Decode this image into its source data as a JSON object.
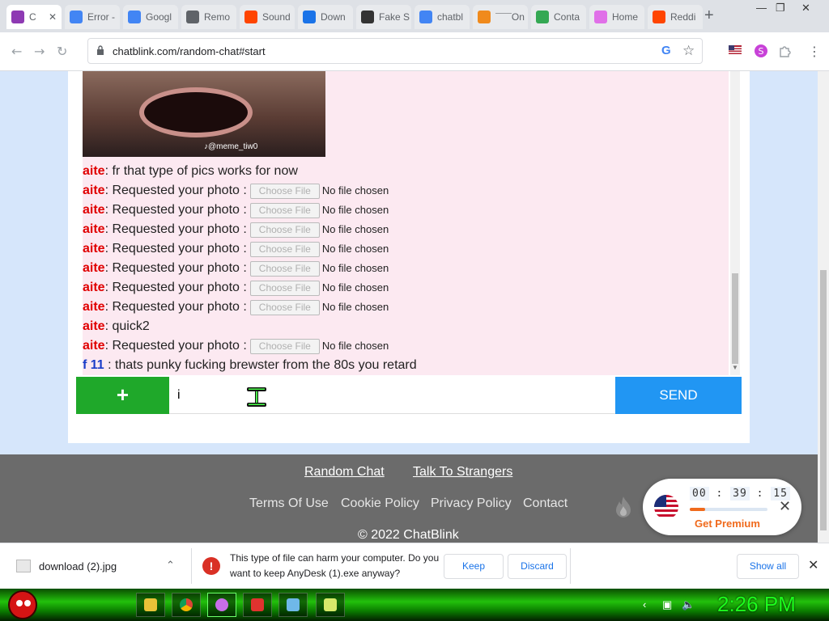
{
  "browser": {
    "tabs": [
      {
        "title": "C",
        "favicon": "chatblink-icon",
        "color": "#8e3ab3",
        "active": true
      },
      {
        "title": "Error -",
        "favicon": "google-icon",
        "color": "#4285f4"
      },
      {
        "title": "Googl",
        "favicon": "google-icon",
        "color": "#4285f4"
      },
      {
        "title": "Remo",
        "favicon": "globe-icon",
        "color": "#5f6368"
      },
      {
        "title": "Sound",
        "favicon": "reddit-icon",
        "color": "#ff4500"
      },
      {
        "title": "Down",
        "favicon": "download-icon",
        "color": "#1a73e8"
      },
      {
        "title": "Fake S",
        "favicon": "spy-icon",
        "color": "#333333"
      },
      {
        "title": "chatbl",
        "favicon": "google-icon",
        "color": "#4285f4"
      },
      {
        "title": "¯¯¯On",
        "favicon": "omegle-icon",
        "color": "#f08a1c"
      },
      {
        "title": "Conta",
        "favicon": "play-icon",
        "color": "#34a853"
      },
      {
        "title": "Home",
        "favicon": "home-icon",
        "color": "#e070e8"
      },
      {
        "title": "Reddi",
        "favicon": "reddit-icon",
        "color": "#ff4500"
      }
    ],
    "url": "chatblink.com/random-chat#start"
  },
  "chat": {
    "image_tag": "♪@meme_tiw0",
    "messages": [
      {
        "user": "aite",
        "color": "red",
        "text": ": fr that type of pics works for now",
        "file": false
      },
      {
        "user": "aite",
        "color": "red",
        "text": ": Requested your photo :",
        "file": true
      },
      {
        "user": "aite",
        "color": "red",
        "text": ": Requested your photo :",
        "file": true
      },
      {
        "user": "aite",
        "color": "red",
        "text": ": Requested your photo :",
        "file": true
      },
      {
        "user": "aite",
        "color": "red",
        "text": ": Requested your photo :",
        "file": true
      },
      {
        "user": "aite",
        "color": "red",
        "text": ": Requested your photo :",
        "file": true
      },
      {
        "user": "aite",
        "color": "red",
        "text": ": Requested your photo :",
        "file": true
      },
      {
        "user": "aite",
        "color": "red",
        "text": ": Requested your photo :",
        "file": true
      },
      {
        "user": "aite",
        "color": "red",
        "text": ": quick2",
        "file": false
      },
      {
        "user": "aite",
        "color": "red",
        "text": ": Requested your photo :",
        "file": true
      },
      {
        "user": "f 11",
        "color": "blue",
        "text": " : thats punky fucking brewster from the 80s you retard",
        "file": false
      }
    ],
    "file_button": "Choose File",
    "no_file": "No file chosen",
    "add_label": "+",
    "input_value": "i",
    "send_label": "SEND"
  },
  "footer": {
    "link1": "Random Chat",
    "link2": "Talk To Strangers",
    "terms": "Terms Of Use",
    "cookie": "Cookie Policy",
    "privacy": "Privacy Policy",
    "contact": "Contact",
    "copyright": "© 2022 ChatBlink"
  },
  "timer": {
    "hours": "00",
    "minutes": "39",
    "seconds": "15",
    "progress": 0.2,
    "premium": "Get Premium"
  },
  "download": {
    "filename": "download (2).jpg",
    "warning": "This type of file can harm your computer. Do you want to keep AnyDesk (1).exe anyway?",
    "keep": "Keep",
    "discard": "Discard",
    "show_all": "Show all"
  },
  "taskbar": {
    "clock": "2:26 PM"
  }
}
